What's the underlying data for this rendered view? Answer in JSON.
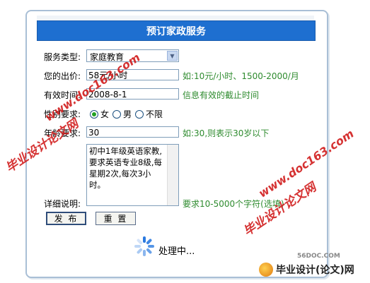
{
  "form": {
    "title": "预订家政服务",
    "fields": {
      "service_type": {
        "label": "服务类型:",
        "value": "家庭教育"
      },
      "price": {
        "label": "您的出价:",
        "value": "58元/小时",
        "hint": "如:10元/小时、1500-2000/月"
      },
      "valid_time": {
        "label": "有效时间:",
        "value": "2008-8-1",
        "hint": "信息有效的截止时间"
      },
      "gender": {
        "label": "性别要求:",
        "options": [
          "女",
          "男",
          "不限"
        ],
        "selected": "女"
      },
      "age": {
        "label": "年龄要求:",
        "value": "30",
        "hint": "如:30,则表示30岁以下"
      },
      "detail": {
        "label": "详细说明:",
        "value": "初中1年级英语家教,要求英语专业8级,每星期2次,每次3小时。",
        "hint": "要求10-5000个字符(选填)"
      }
    },
    "buttons": {
      "submit": "发 布",
      "reset": "重 置"
    },
    "status": "处理中..."
  },
  "watermarks": {
    "site_text": "毕业设计论文网",
    "url_text": "www.doc163.com",
    "badge": "56DOC.COM",
    "logo_text": "毕业设计(论文)网"
  },
  "colors": {
    "header_bg": "#1e6fd0",
    "hint": "#2e8b2e",
    "watermark": "#d11c1c"
  }
}
